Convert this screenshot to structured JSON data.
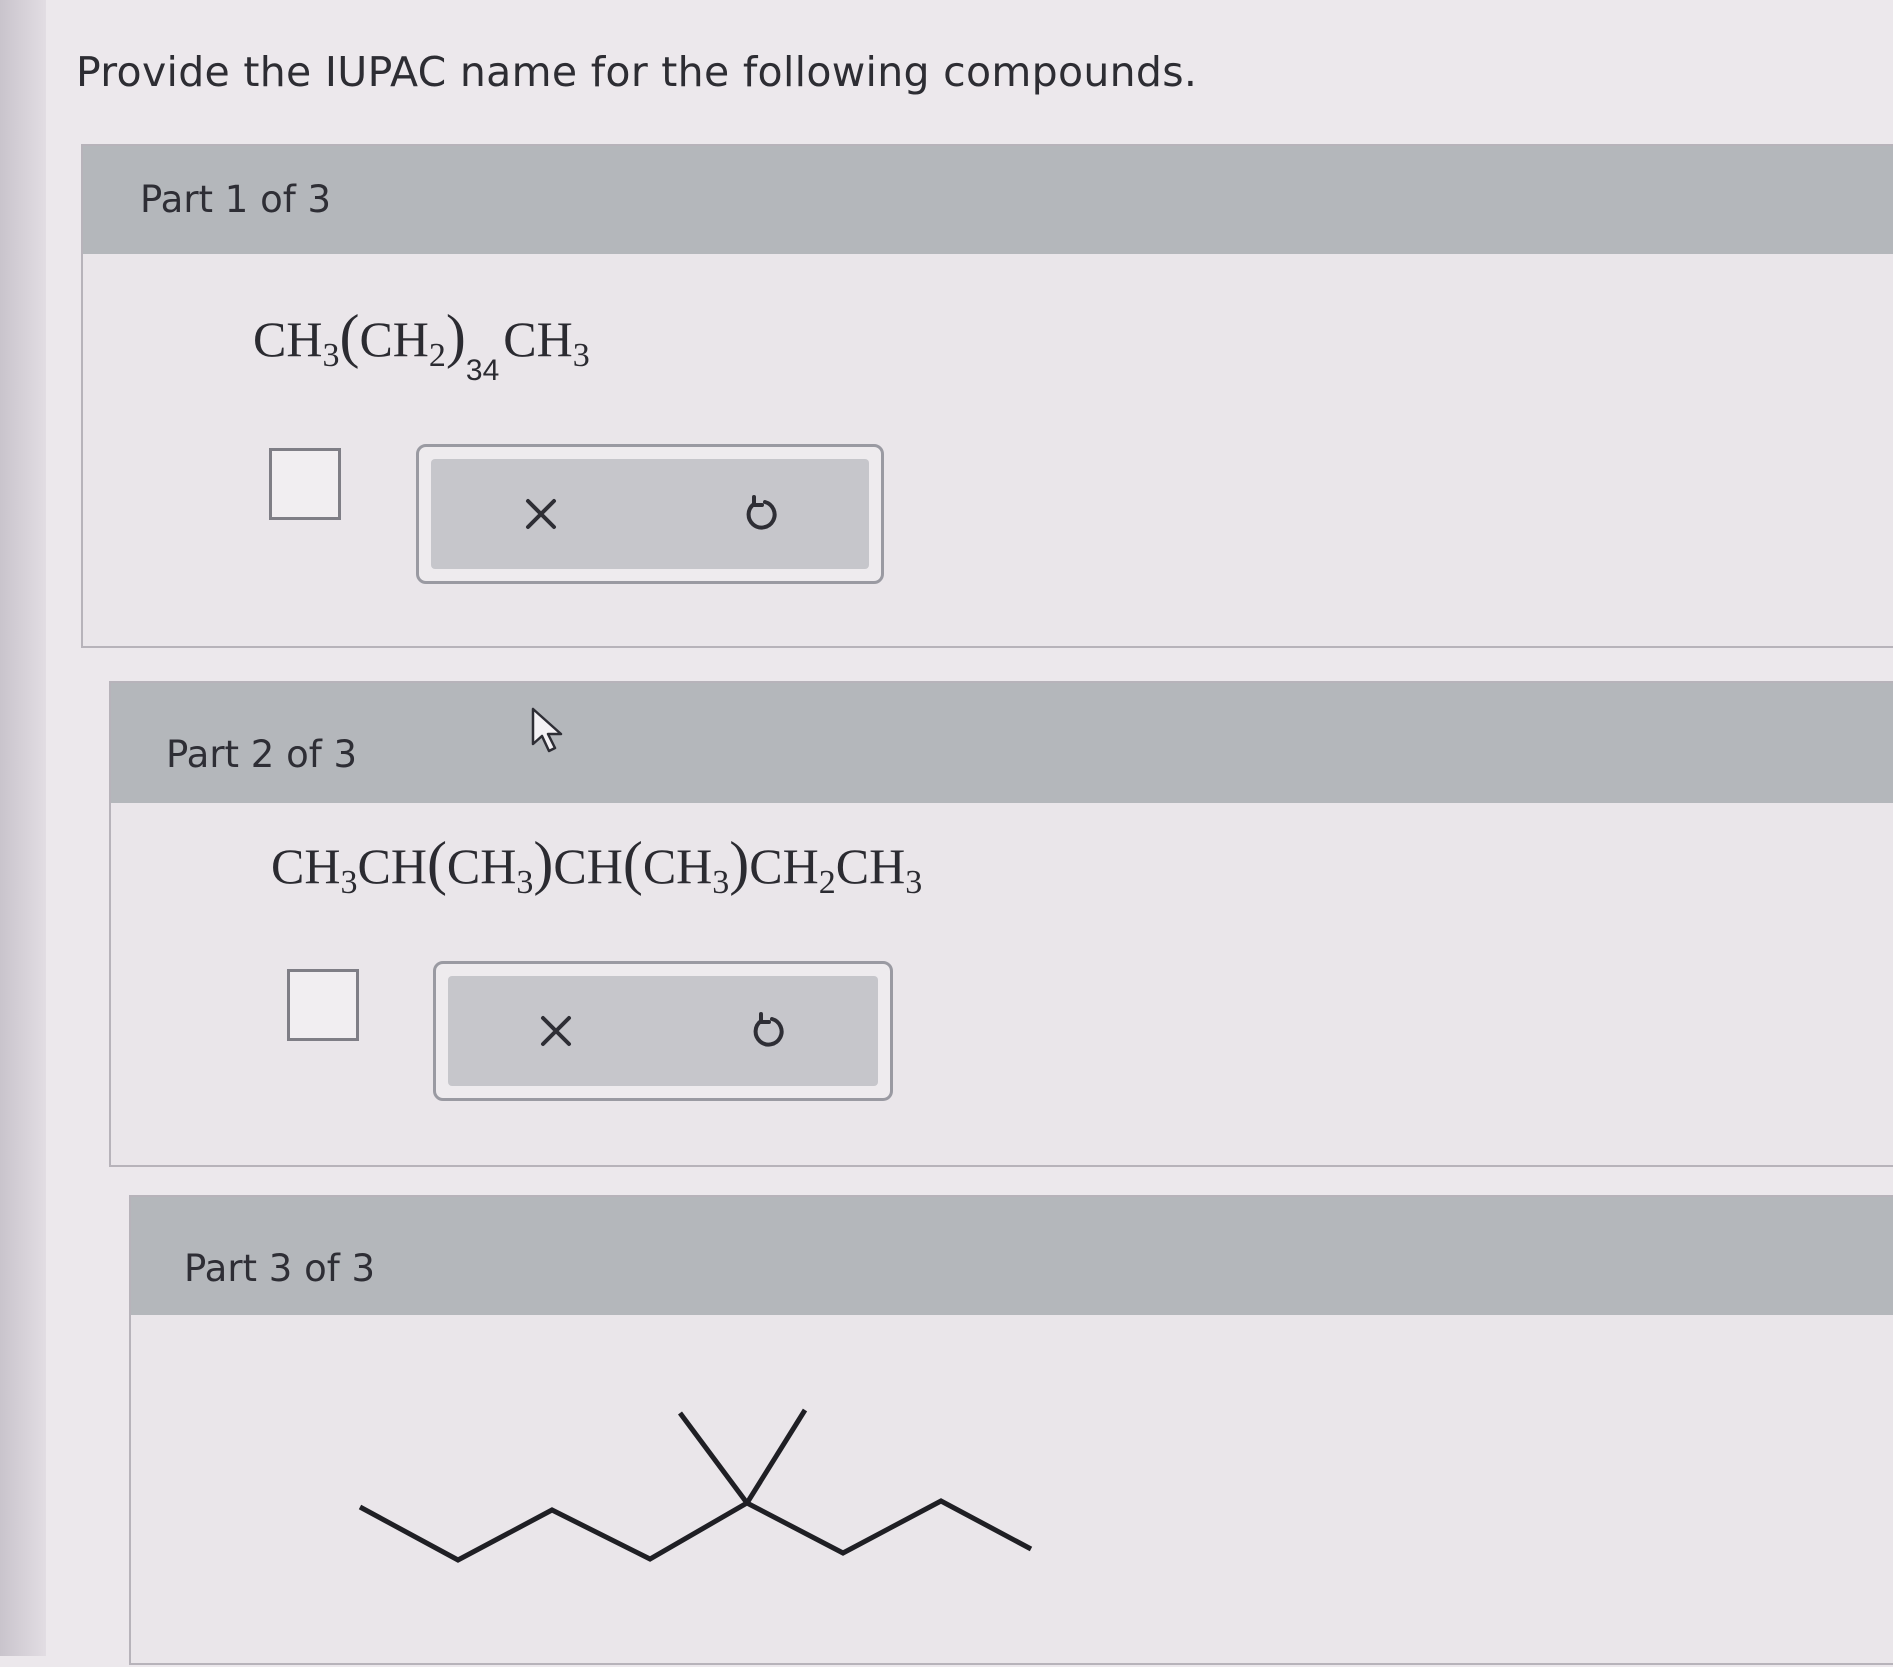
{
  "question": {
    "text": "Provide the IUPAC name for the following compounds."
  },
  "parts": [
    {
      "label": "Part 1 of 3",
      "formula": {
        "a": "CH",
        "a_sub": "3",
        "b_open": "(",
        "b": "CH",
        "b_sub": "2",
        "b_close": ")",
        "repeat": "34",
        "c": "CH",
        "c_sub": "3"
      },
      "answer": "",
      "toolbar": {
        "clear_icon": "close-icon",
        "undo_icon": "undo-icon"
      }
    },
    {
      "label": "Part 2 of 3",
      "formula": {
        "t1": "CH",
        "s1": "3",
        "t2": "CH",
        "p1": "(",
        "t3": "CH",
        "s3": "3",
        "p2": ")",
        "t4": "CH",
        "p3": "(",
        "t5": "CH",
        "s5": "3",
        "p4": ")",
        "t6": "CH",
        "s6": "2",
        "t7": "CH",
        "s7": "3"
      },
      "answer": "",
      "toolbar": {
        "clear_icon": "close-icon",
        "undo_icon": "undo-icon"
      }
    },
    {
      "label": "Part 3 of 3",
      "structure": "skeletal-formula"
    }
  ],
  "colors": {
    "header_bg": "#b4b7bb",
    "panel_bg": "#eae6ea",
    "toolbar_inner": "#c6c6cb"
  }
}
